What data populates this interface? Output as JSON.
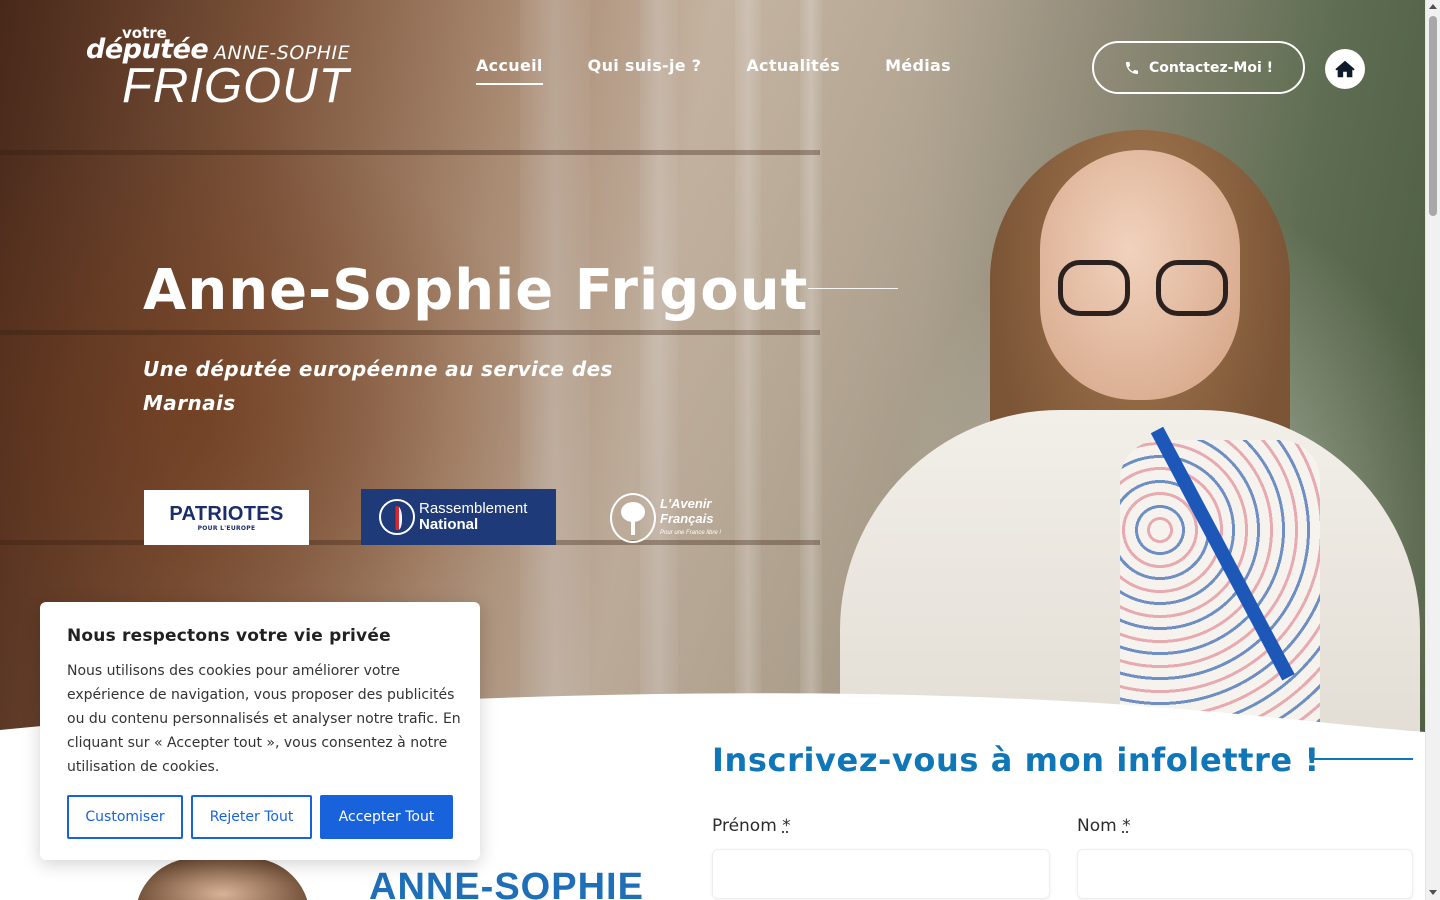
{
  "header": {
    "logo": {
      "line_votre": "votre",
      "line_deputee": "députée",
      "line_firstname": "ANNE-SOPHIE",
      "line_lastname": "FRIGOUT"
    },
    "nav": [
      {
        "label": "Accueil",
        "active": true
      },
      {
        "label": "Qui suis-je ?",
        "active": false
      },
      {
        "label": "Actualités",
        "active": false
      },
      {
        "label": "Médias",
        "active": false
      }
    ],
    "contact_button": "Contactez-Moi !",
    "phone_icon": "phone-icon",
    "home_icon": "home-icon"
  },
  "hero": {
    "title": "Anne-Sophie Frigout",
    "subtitle": "Une députée européenne au service des Marnais",
    "partners": {
      "patriotes": {
        "name": "PATRIOTES",
        "tagline": "POUR L'EUROPE"
      },
      "rn": {
        "line1": "Rassemblement",
        "line2": "National"
      },
      "avenir": {
        "line1": "L'Avenir",
        "line2": "Français",
        "tagline": "Pour une France libre !"
      }
    }
  },
  "newsletter": {
    "title": "Inscrivez-vous à mon infolettre !",
    "fields": [
      {
        "label": "Prénom",
        "required_mark": "*",
        "value": ""
      },
      {
        "label": "Nom",
        "required_mark": "*",
        "value": ""
      }
    ]
  },
  "below_fold": {
    "name_banner": "ANNE-SOPHIE"
  },
  "cookie_banner": {
    "title": "Nous respectons votre vie privée",
    "text": "Nous utilisons des cookies pour améliorer votre expérience de navigation, vous proposer des publicités ou du contenu personnalisés et analyser notre trafic. En cliquant sur « Accepter tout », vous consentez à notre utilisation de cookies.",
    "buttons": {
      "customize": "Customiser",
      "reject": "Rejeter Tout",
      "accept": "Accepter Tout"
    }
  },
  "colors": {
    "accent_blue": "#0f76b8",
    "cookie_blue": "#1863dc",
    "rn_navy": "#1e3a78"
  }
}
